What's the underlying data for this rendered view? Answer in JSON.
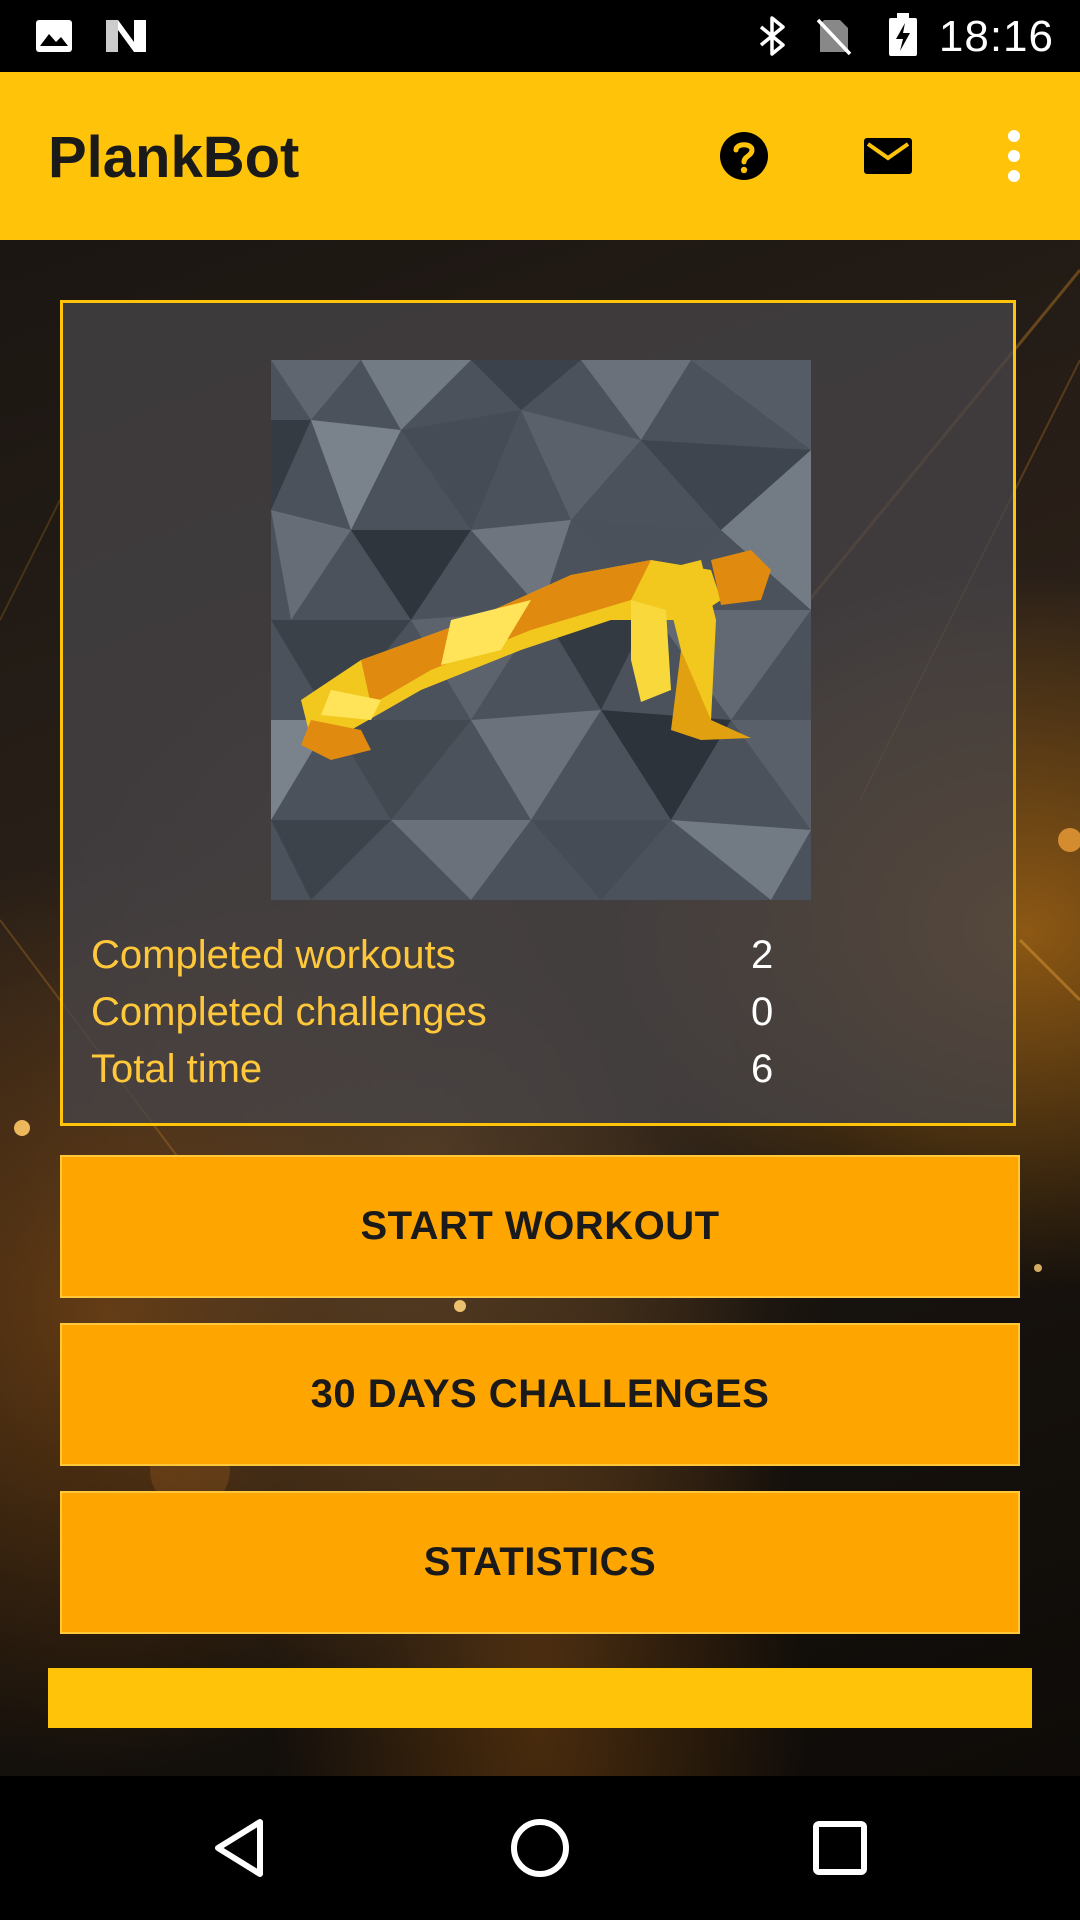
{
  "status_bar": {
    "time": "18:16",
    "icons": [
      "image-icon",
      "n-notification-icon",
      "bluetooth-icon",
      "no-sim-icon",
      "battery-charging-icon"
    ]
  },
  "app_bar": {
    "title": "PlankBot",
    "actions": [
      "help-icon",
      "mail-icon",
      "more-vert-icon"
    ]
  },
  "stats": {
    "rows": [
      {
        "label": "Completed workouts",
        "value": "2"
      },
      {
        "label": "Completed challenges",
        "value": "0"
      },
      {
        "label": "Total time",
        "value": "6"
      }
    ]
  },
  "buttons": {
    "start_workout": "START WORKOUT",
    "challenges": "30 DAYS CHALLENGES",
    "statistics": "STATISTICS"
  },
  "nav_bar": {
    "buttons": [
      "back-icon",
      "home-icon",
      "recents-icon"
    ]
  },
  "colors": {
    "accent": "#FFC40A",
    "button": "#FFA500",
    "stat_label": "#FFC83A"
  }
}
